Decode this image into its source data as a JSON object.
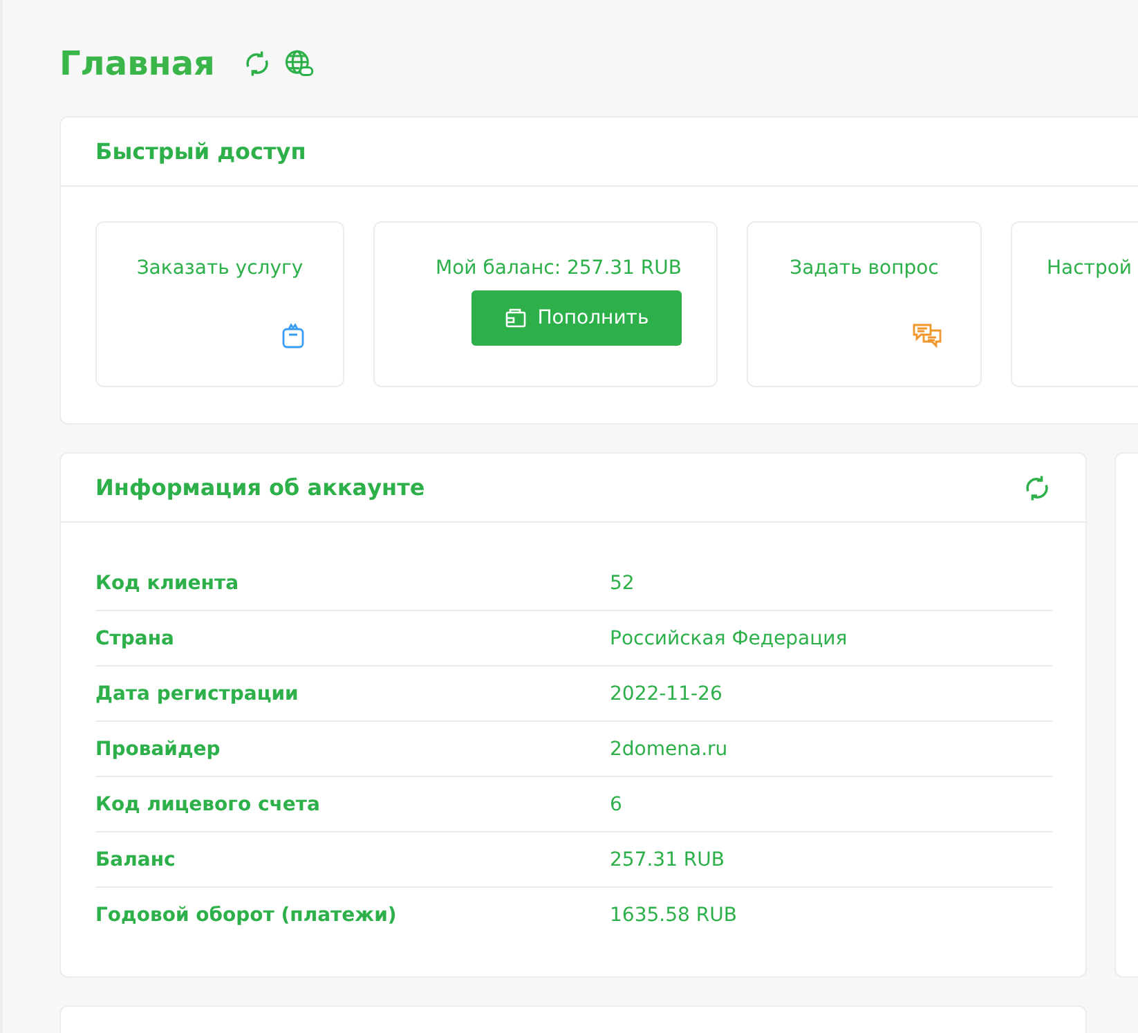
{
  "page_title": "Главная",
  "quick_access": {
    "title": "Быстрый доступ",
    "tiles": [
      {
        "kind": "bag",
        "label": "Заказать услугу"
      },
      {
        "kind": "button",
        "label": "Мой баланс: 257.31 RUB",
        "button": "Пополнить"
      },
      {
        "kind": "chat",
        "label": "Задать вопрос"
      },
      {
        "kind": "plain",
        "label": "Настрой"
      }
    ]
  },
  "account_info": {
    "title": "Информация об аккаунте",
    "rows": [
      {
        "label": "Код клиента",
        "value": "52"
      },
      {
        "label": "Страна",
        "value": "Российская Федерация"
      },
      {
        "label": "Дата регистрации",
        "value": "2022-11-26"
      },
      {
        "label": "Провайдер",
        "value": "2domena.ru"
      },
      {
        "label": "Код лицевого счета",
        "value": "6"
      },
      {
        "label": "Баланс",
        "value": "257.31 RUB"
      },
      {
        "label": "Годовой оборот (платежи)",
        "value": "1635.58 RUB"
      }
    ]
  }
}
